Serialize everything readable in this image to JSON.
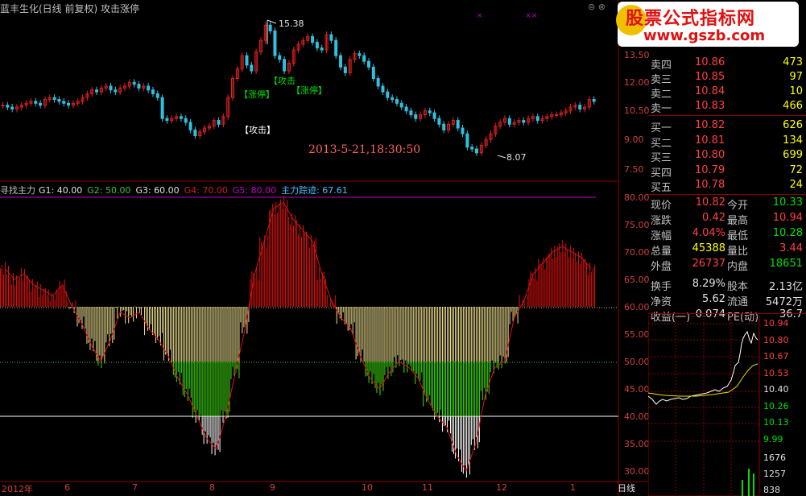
{
  "title": "蓝丰生化(日线 前复权) 攻击涨停",
  "main_chart": {
    "high_label": "15.38",
    "low_label": "8.07",
    "timestamp": "2013-5-21,18:30:50",
    "annotations": [
      "【攻击",
      "【涨停】",
      "【涨停】",
      "【攻击】"
    ],
    "price_ticks": [
      "13.50",
      "12.00",
      "10.50",
      "9.00",
      "7.50"
    ]
  },
  "indicator": {
    "name": "寻找主力",
    "g1": "G1: 40.00",
    "g2": "G2: 50.00",
    "g3": "G3: 60.00",
    "g4": "G4: 70.00",
    "g5": "G5: 80.00",
    "track": "主力踪迹: 67.61",
    "ticks": [
      "80.00",
      "75.00",
      "70.00",
      "65.00",
      "60.00",
      "55.00",
      "50.00",
      "45.00",
      "40.00",
      "35.00",
      "30.00"
    ]
  },
  "dates": [
    "2012年",
    "6",
    "7",
    "8",
    "9",
    "10",
    "11",
    "12",
    "1"
  ],
  "period_label": "日线",
  "quotes": {
    "sell": [
      {
        "label": "卖四",
        "price": "10.86",
        "vol": "473"
      },
      {
        "label": "卖三",
        "price": "10.85",
        "vol": "97"
      },
      {
        "label": "卖二",
        "price": "10.84",
        "vol": "10"
      },
      {
        "label": "卖一",
        "price": "10.83",
        "vol": "466"
      }
    ],
    "buy": [
      {
        "label": "买一",
        "price": "10.82",
        "vol": "626"
      },
      {
        "label": "买二",
        "price": "10.81",
        "vol": "134"
      },
      {
        "label": "买三",
        "price": "10.80",
        "vol": "699"
      },
      {
        "label": "买四",
        "price": "10.79",
        "vol": "72"
      },
      {
        "label": "买五",
        "price": "10.78",
        "vol": "24"
      }
    ]
  },
  "stats": {
    "xianjia_l": "现价",
    "xianjia_v": "10.82",
    "jinkai_l": "今开",
    "jinkai_v": "10.33",
    "zhangdie_l": "涨跌",
    "zhangdie_v": "0.42",
    "zuigao_l": "最高",
    "zuigao_v": "10.94",
    "zhangfu_l": "涨幅",
    "zhangfu_v": "4.04%",
    "zuidi_l": "最低",
    "zuidi_v": "10.28",
    "zongliang_l": "总量",
    "zongliang_v": "45388",
    "liangbi_l": "量比",
    "liangbi_v": "3.44",
    "waipan_l": "外盘",
    "waipan_v": "26737",
    "neipan_l": "内盘",
    "neipan_v": "18651",
    "huanshou_l": "换手",
    "huanshou_v": "8.29%",
    "guben_l": "股本",
    "guben_v": "2.13亿",
    "jingzi_l": "净资",
    "jingzi_v": "5.62",
    "liutong_l": "流通",
    "liutong_v": "5472万",
    "shouyi_l": "收益(一)",
    "shouyi_v": "0.074",
    "pe_l": "PE(动)",
    "pe_v": "36.7"
  },
  "mini_chart": {
    "ticks": [
      "10.94",
      "10.80",
      "10.67",
      "10.53",
      "10.40",
      "10.26",
      "10.13",
      "9.99"
    ],
    "vol_ticks": [
      "1676",
      "1257",
      "838"
    ]
  },
  "watermark": {
    "line1": "股票公式指标网",
    "line2": "www.gszb.com"
  },
  "chart_data": {
    "type": "bar",
    "title": "寻找主力",
    "levels": {
      "G1": 40,
      "G2": 50,
      "G3": 60,
      "G4": 70,
      "G5": 80
    },
    "current_value": 67.61,
    "ylim": [
      30,
      80
    ],
    "values": [
      67,
      65,
      66,
      64,
      63,
      62,
      64,
      60,
      57,
      53,
      50,
      54,
      59,
      58,
      59,
      56,
      54,
      51,
      47,
      44,
      40,
      36,
      34,
      40,
      48,
      56,
      66,
      72,
      78,
      79,
      76,
      74,
      72,
      66,
      61,
      58,
      56,
      51,
      47,
      45,
      48,
      50,
      49,
      47,
      43,
      40,
      38,
      33,
      30,
      35,
      44,
      49,
      50,
      58,
      61,
      66,
      68,
      70,
      71,
      70,
      69,
      67
    ]
  },
  "colors": {
    "red": "#e01010",
    "yellow": "#f0e090",
    "green": "#40e010",
    "white": "#ffffff",
    "axis": "#8b0000"
  }
}
